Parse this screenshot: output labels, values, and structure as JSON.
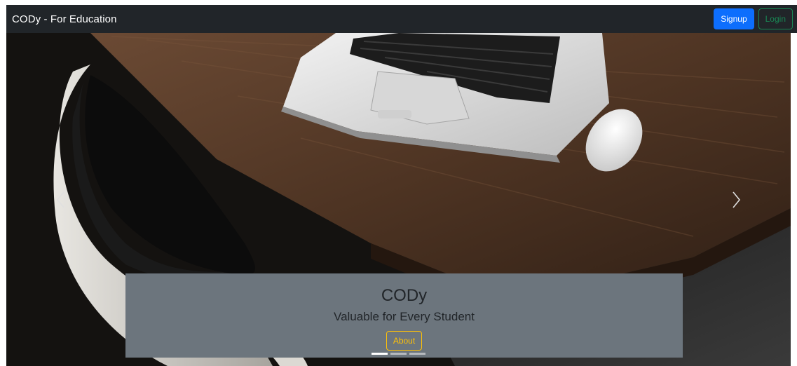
{
  "navbar": {
    "brand": "CODy - For Education",
    "signup_label": "Signup",
    "login_label": "Login"
  },
  "carousel": {
    "slides": [
      {
        "title": "CODy",
        "subtitle": "Valuable for Every Student",
        "button_label": "About"
      }
    ],
    "active_slide": 1,
    "slide_count": 3
  },
  "icons": {
    "prev": "chevron-left-icon",
    "next": "chevron-right-icon"
  },
  "colors": {
    "navbar_bg": "#212529",
    "signup": "#0d6efd",
    "login": "#198754",
    "caption_bg": "#6c757d",
    "about": "#ffc107"
  }
}
